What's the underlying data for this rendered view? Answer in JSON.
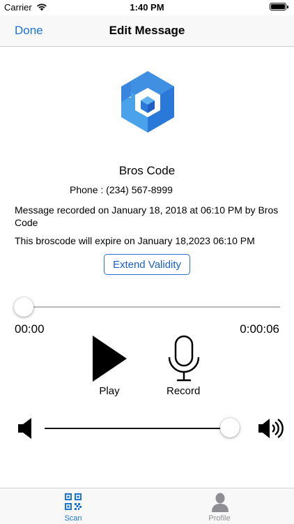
{
  "status_bar": {
    "carrier": "Carrier",
    "time": "1:40 PM"
  },
  "nav": {
    "done_label": "Done",
    "title": "Edit Message"
  },
  "brand": {
    "name": "Bros Code",
    "logo_icon": "hexagon-b-logo-icon"
  },
  "details": {
    "phone": "Phone :  (234) 567-8999",
    "recorded": "Message recorded on January 18, 2018 at 06:10 PM by Bros Code",
    "expiry": "This broscode will expire on January 18,2023 06:10 PM"
  },
  "extend_label": "Extend Validity",
  "player": {
    "progress_fraction": 0.0,
    "time_start": "00:00",
    "time_end": "0:00:06",
    "play_label": "Play",
    "record_label": "Record"
  },
  "volume": {
    "level_fraction": 0.95
  },
  "tabs": [
    {
      "label": "Scan",
      "icon": "qr-code-icon",
      "active": true
    },
    {
      "label": "Profile",
      "icon": "person-icon",
      "active": false
    }
  ],
  "colors": {
    "accent": "#1a73d6",
    "logo_light": "#4aa3ea",
    "logo_dark": "#1f5fc4",
    "inactive_tab": "#8e8e93"
  }
}
